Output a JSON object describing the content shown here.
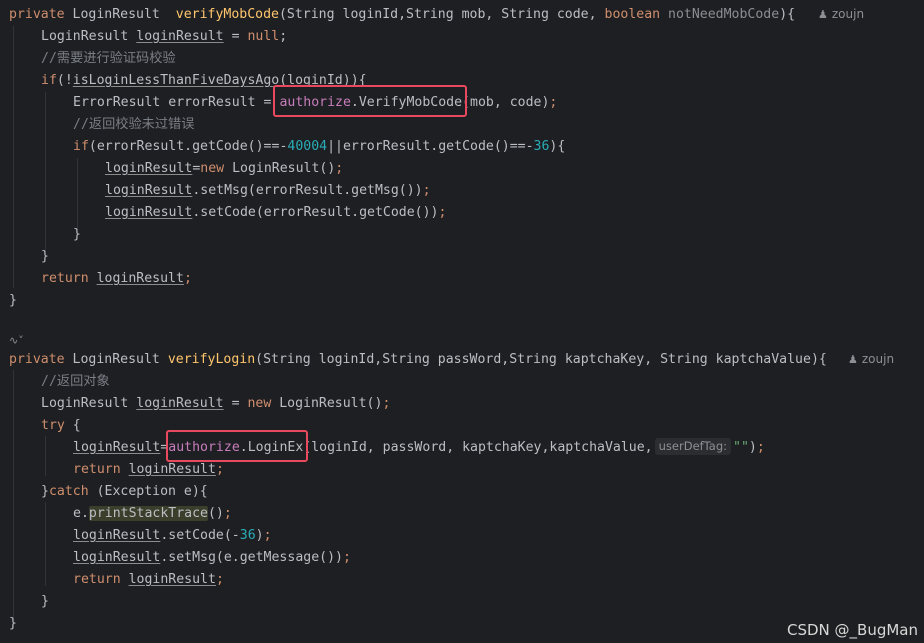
{
  "method1": {
    "signature": {
      "mod": "private",
      "ret": "LoginResult",
      "name": "verifyMobCode",
      "params_a": "(String loginId,String mob, String code, ",
      "bool": "boolean",
      "params_b": " notNeedMobCode",
      "tail": "){"
    },
    "author": "zoujn",
    "comment1": "//需要进行验证码校验",
    "comment2": "//返回校验未过错误"
  },
  "method2": {
    "signature": {
      "mod": "private",
      "ret": "LoginResult",
      "name": "verifyLogin",
      "params": "(String loginId,String passWord,String kaptchaKey, String kaptchaValue){"
    },
    "author": "zoujn",
    "comment1": "//返回对象",
    "hint_label": "userDefTag:",
    "hint_value": "\"\""
  },
  "watermark": "CSDN @_BugMan"
}
